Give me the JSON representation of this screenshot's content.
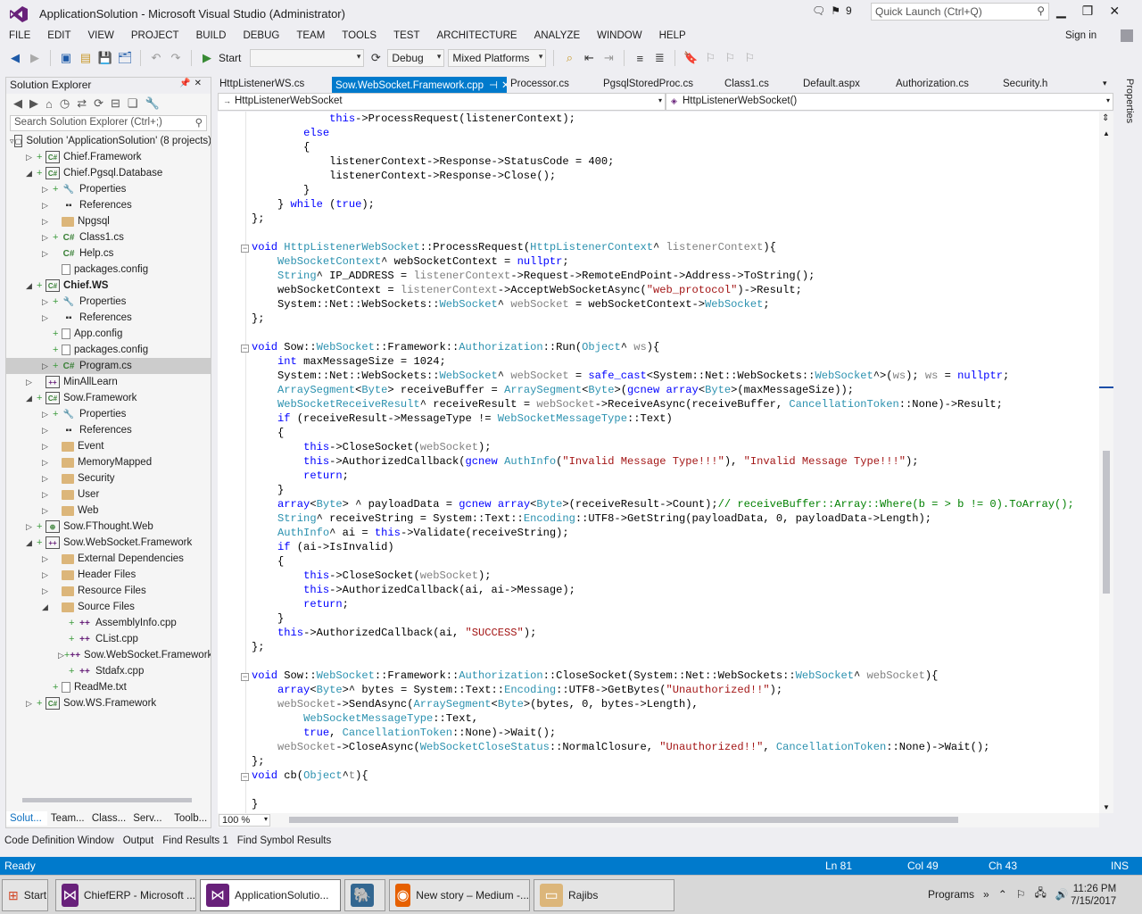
{
  "window": {
    "title": "ApplicationSolution - Microsoft Visual Studio (Administrator)",
    "notification_count": "9",
    "quick_launch_placeholder": "Quick Launch (Ctrl+Q)"
  },
  "menu": [
    "FILE",
    "EDIT",
    "VIEW",
    "PROJECT",
    "BUILD",
    "DEBUG",
    "TEAM",
    "TOOLS",
    "TEST",
    "ARCHITECTURE",
    "ANALYZE",
    "WINDOW",
    "HELP"
  ],
  "signin": "Sign in",
  "toolbar": {
    "start_label": "Start",
    "config": "Debug",
    "platform": "Mixed Platforms"
  },
  "solution_explorer": {
    "title": "Solution Explorer",
    "search_placeholder": "Search Solution Explorer (Ctrl+;)",
    "tree": [
      {
        "label": "Solution 'ApplicationSolution' (8 projects)",
        "icon": "solution-icon"
      },
      {
        "label": "Chief.Framework",
        "icon": "csharp-project-icon"
      },
      {
        "label": "Chief.Pgsql.Database",
        "icon": "csharp-project-icon"
      },
      {
        "label": "Properties",
        "icon": "wrench-icon"
      },
      {
        "label": "References",
        "icon": "references-icon"
      },
      {
        "label": "Npgsql",
        "icon": "folder-icon"
      },
      {
        "label": "Class1.cs",
        "icon": "csharp-file-icon"
      },
      {
        "label": "Help.cs",
        "icon": "csharp-file-icon"
      },
      {
        "label": "packages.config",
        "icon": "config-file-icon"
      },
      {
        "label": "Chief.WS",
        "icon": "csharp-project-icon"
      },
      {
        "label": "Properties",
        "icon": "wrench-icon"
      },
      {
        "label": "References",
        "icon": "references-icon"
      },
      {
        "label": "App.config",
        "icon": "config-file-icon"
      },
      {
        "label": "packages.config",
        "icon": "config-file-icon"
      },
      {
        "label": "Program.cs",
        "icon": "csharp-file-icon"
      },
      {
        "label": "MinAllLearn",
        "icon": "cpp-project-icon"
      },
      {
        "label": "Sow.Framework",
        "icon": "csharp-project-icon"
      },
      {
        "label": "Properties",
        "icon": "wrench-icon"
      },
      {
        "label": "References",
        "icon": "references-icon"
      },
      {
        "label": "Event",
        "icon": "folder-icon"
      },
      {
        "label": "MemoryMapped",
        "icon": "folder-icon"
      },
      {
        "label": "Security",
        "icon": "folder-icon"
      },
      {
        "label": "User",
        "icon": "folder-icon"
      },
      {
        "label": "Web",
        "icon": "folder-icon"
      },
      {
        "label": "Sow.FThought.Web",
        "icon": "web-project-icon"
      },
      {
        "label": "Sow.WebSocket.Framework",
        "icon": "cpp-project-icon"
      },
      {
        "label": "External Dependencies",
        "icon": "dependencies-icon"
      },
      {
        "label": "Header Files",
        "icon": "folder-icon"
      },
      {
        "label": "Resource Files",
        "icon": "folder-icon"
      },
      {
        "label": "Source Files",
        "icon": "folder-icon"
      },
      {
        "label": "AssemblyInfo.cpp",
        "icon": "cpp-file-icon"
      },
      {
        "label": "CList.cpp",
        "icon": "cpp-file-icon"
      },
      {
        "label": "Sow.WebSocket.Framework.c",
        "icon": "cpp-file-icon"
      },
      {
        "label": "Stdafx.cpp",
        "icon": "cpp-file-icon"
      },
      {
        "label": "ReadMe.txt",
        "icon": "text-file-icon"
      },
      {
        "label": "Sow.WS.Framework",
        "icon": "csharp-project-icon"
      }
    ],
    "bottom_tabs": [
      "Solut...",
      "Team...",
      "Class...",
      "Serv...",
      "Toolb..."
    ]
  },
  "editor_tabs": [
    {
      "label": "HttpListenerWS.cs"
    },
    {
      "label": "Sow.WebSocket.Framework.cpp",
      "active": true
    },
    {
      "label": "Processor.cs"
    },
    {
      "label": "PgsqlStoredProc.cs"
    },
    {
      "label": "Class1.cs"
    },
    {
      "label": "Default.aspx"
    },
    {
      "label": "Authorization.cs"
    },
    {
      "label": "Security.h"
    }
  ],
  "properties_tab": "Properties",
  "navbar": {
    "scope": "HttpListenerWebSocket",
    "member": "HttpListenerWebSocket()"
  },
  "code_lines": [
    "            this->ProcessRequest(listenerContext);",
    "        else",
    "        {",
    "            listenerContext->Response->StatusCode = 400;",
    "            listenerContext->Response->Close();",
    "        }",
    "    } while (true);",
    "};",
    "",
    "void HttpListenerWebSocket::ProcessRequest(HttpListenerContext^ listenerContext){",
    "    WebSocketContext^ webSocketContext = nullptr;",
    "    String^ IP_ADDRESS = listenerContext->Request->RemoteEndPoint->Address->ToString();",
    "    webSocketContext = listenerContext->AcceptWebSocketAsync(\"web_protocol\")->Result;",
    "    System::Net::WebSockets::WebSocket^ webSocket = webSocketContext->WebSocket;",
    "};",
    "",
    "void Sow::WebSocket::Framework::Authorization::Run(Object^ ws){",
    "    int maxMessageSize = 1024;",
    "    System::Net::WebSockets::WebSocket^ webSocket = safe_cast<System::Net::WebSockets::WebSocket^>(ws); ws = nullptr;",
    "    ArraySegment<Byte> receiveBuffer = ArraySegment<Byte>(gcnew array<Byte>(maxMessageSize));",
    "    WebSocketReceiveResult^ receiveResult = webSocket->ReceiveAsync(receiveBuffer, CancellationToken::None)->Result;",
    "    if (receiveResult->MessageType != WebSocketMessageType::Text)",
    "    {",
    "        this->CloseSocket(webSocket);",
    "        this->AuthorizedCallback(gcnew AuthInfo(\"Invalid Message Type!!!\"), \"Invalid Message Type!!!\");",
    "        return;",
    "    }",
    "    array<Byte> ^ payloadData = gcnew array<Byte>(receiveResult->Count);// receiveBuffer::Array::Where(b = > b != 0).ToArray();",
    "    String^ receiveString = System::Text::Encoding::UTF8->GetString(payloadData, 0, payloadData->Length);",
    "    AuthInfo^ ai = this->Validate(receiveString);",
    "    if (ai->IsInvalid)",
    "    {",
    "        this->CloseSocket(webSocket);",
    "        this->AuthorizedCallback(ai, ai->Message);",
    "        return;",
    "    }",
    "    this->AuthorizedCallback(ai, \"SUCCESS\");",
    "};",
    "",
    "void Sow::WebSocket::Framework::Authorization::CloseSocket(System::Net::WebSockets::WebSocket^ webSocket){",
    "    array<Byte>^ bytes = System::Text::Encoding::UTF8->GetBytes(\"Unauthorized!!\");",
    "    webSocket->SendAsync(ArraySegment<Byte>(bytes, 0, bytes->Length),",
    "        WebSocketMessageType::Text,",
    "        true, CancellationToken::None)->Wait();",
    "    webSocket->CloseAsync(WebSocketCloseStatus::NormalClosure, \"Unauthorized!!\", CancellationToken::None)->Wait();",
    "};",
    "void cb(Object^t){",
    "",
    "}"
  ],
  "zoom": "100 %",
  "output_tabs": [
    "Code Definition Window",
    "Output",
    "Find Results 1",
    "Find Symbol Results"
  ],
  "status": {
    "state": "Ready",
    "line": "Ln 81",
    "col": "Col 49",
    "ch": "Ch 43",
    "mode": "INS"
  },
  "taskbar": {
    "start": "Start",
    "buttons": [
      {
        "label": "ChiefERP - Microsoft ...",
        "icon": "visual-studio-icon"
      },
      {
        "label": "ApplicationSolutio...",
        "icon": "visual-studio-icon",
        "active": true
      },
      {
        "label": "",
        "icon": "postgresql-icon"
      },
      {
        "label": "New story – Medium -...",
        "icon": "firefox-icon"
      },
      {
        "label": "Rajibs",
        "icon": "folder-icon"
      }
    ],
    "programs": "Programs",
    "time": "11:26 PM",
    "date": "7/15/2017"
  },
  "colors": {
    "accent": "#007acc",
    "keyword": "#0000ff",
    "type": "#2b91af",
    "string": "#a31515",
    "comment": "#008000"
  }
}
